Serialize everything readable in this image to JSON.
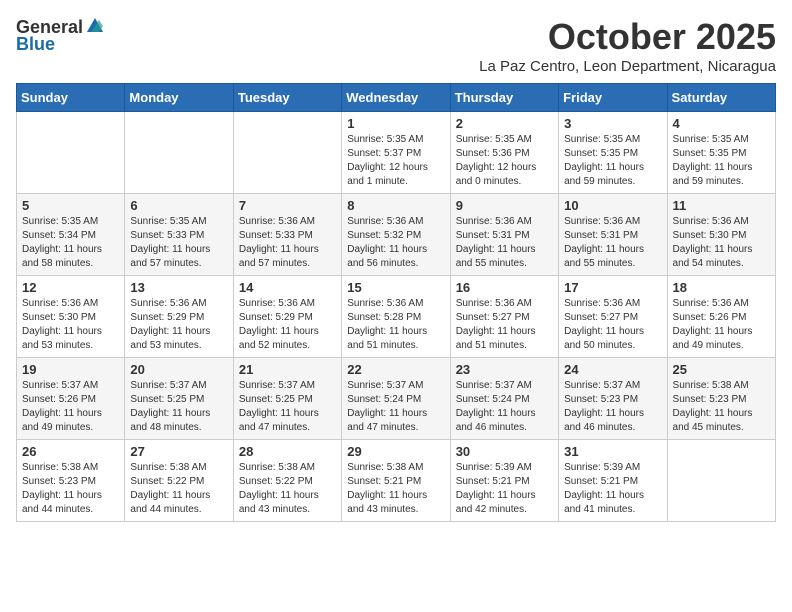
{
  "header": {
    "logo_general": "General",
    "logo_blue": "Blue",
    "month": "October 2025",
    "location": "La Paz Centro, Leon Department, Nicaragua"
  },
  "weekdays": [
    "Sunday",
    "Monday",
    "Tuesday",
    "Wednesday",
    "Thursday",
    "Friday",
    "Saturday"
  ],
  "weeks": [
    [
      {
        "day": "",
        "info": ""
      },
      {
        "day": "",
        "info": ""
      },
      {
        "day": "",
        "info": ""
      },
      {
        "day": "1",
        "info": "Sunrise: 5:35 AM\nSunset: 5:37 PM\nDaylight: 12 hours\nand 1 minute."
      },
      {
        "day": "2",
        "info": "Sunrise: 5:35 AM\nSunset: 5:36 PM\nDaylight: 12 hours\nand 0 minutes."
      },
      {
        "day": "3",
        "info": "Sunrise: 5:35 AM\nSunset: 5:35 PM\nDaylight: 11 hours\nand 59 minutes."
      },
      {
        "day": "4",
        "info": "Sunrise: 5:35 AM\nSunset: 5:35 PM\nDaylight: 11 hours\nand 59 minutes."
      }
    ],
    [
      {
        "day": "5",
        "info": "Sunrise: 5:35 AM\nSunset: 5:34 PM\nDaylight: 11 hours\nand 58 minutes."
      },
      {
        "day": "6",
        "info": "Sunrise: 5:35 AM\nSunset: 5:33 PM\nDaylight: 11 hours\nand 57 minutes."
      },
      {
        "day": "7",
        "info": "Sunrise: 5:36 AM\nSunset: 5:33 PM\nDaylight: 11 hours\nand 57 minutes."
      },
      {
        "day": "8",
        "info": "Sunrise: 5:36 AM\nSunset: 5:32 PM\nDaylight: 11 hours\nand 56 minutes."
      },
      {
        "day": "9",
        "info": "Sunrise: 5:36 AM\nSunset: 5:31 PM\nDaylight: 11 hours\nand 55 minutes."
      },
      {
        "day": "10",
        "info": "Sunrise: 5:36 AM\nSunset: 5:31 PM\nDaylight: 11 hours\nand 55 minutes."
      },
      {
        "day": "11",
        "info": "Sunrise: 5:36 AM\nSunset: 5:30 PM\nDaylight: 11 hours\nand 54 minutes."
      }
    ],
    [
      {
        "day": "12",
        "info": "Sunrise: 5:36 AM\nSunset: 5:30 PM\nDaylight: 11 hours\nand 53 minutes."
      },
      {
        "day": "13",
        "info": "Sunrise: 5:36 AM\nSunset: 5:29 PM\nDaylight: 11 hours\nand 53 minutes."
      },
      {
        "day": "14",
        "info": "Sunrise: 5:36 AM\nSunset: 5:29 PM\nDaylight: 11 hours\nand 52 minutes."
      },
      {
        "day": "15",
        "info": "Sunrise: 5:36 AM\nSunset: 5:28 PM\nDaylight: 11 hours\nand 51 minutes."
      },
      {
        "day": "16",
        "info": "Sunrise: 5:36 AM\nSunset: 5:27 PM\nDaylight: 11 hours\nand 51 minutes."
      },
      {
        "day": "17",
        "info": "Sunrise: 5:36 AM\nSunset: 5:27 PM\nDaylight: 11 hours\nand 50 minutes."
      },
      {
        "day": "18",
        "info": "Sunrise: 5:36 AM\nSunset: 5:26 PM\nDaylight: 11 hours\nand 49 minutes."
      }
    ],
    [
      {
        "day": "19",
        "info": "Sunrise: 5:37 AM\nSunset: 5:26 PM\nDaylight: 11 hours\nand 49 minutes."
      },
      {
        "day": "20",
        "info": "Sunrise: 5:37 AM\nSunset: 5:25 PM\nDaylight: 11 hours\nand 48 minutes."
      },
      {
        "day": "21",
        "info": "Sunrise: 5:37 AM\nSunset: 5:25 PM\nDaylight: 11 hours\nand 47 minutes."
      },
      {
        "day": "22",
        "info": "Sunrise: 5:37 AM\nSunset: 5:24 PM\nDaylight: 11 hours\nand 47 minutes."
      },
      {
        "day": "23",
        "info": "Sunrise: 5:37 AM\nSunset: 5:24 PM\nDaylight: 11 hours\nand 46 minutes."
      },
      {
        "day": "24",
        "info": "Sunrise: 5:37 AM\nSunset: 5:23 PM\nDaylight: 11 hours\nand 46 minutes."
      },
      {
        "day": "25",
        "info": "Sunrise: 5:38 AM\nSunset: 5:23 PM\nDaylight: 11 hours\nand 45 minutes."
      }
    ],
    [
      {
        "day": "26",
        "info": "Sunrise: 5:38 AM\nSunset: 5:23 PM\nDaylight: 11 hours\nand 44 minutes."
      },
      {
        "day": "27",
        "info": "Sunrise: 5:38 AM\nSunset: 5:22 PM\nDaylight: 11 hours\nand 44 minutes."
      },
      {
        "day": "28",
        "info": "Sunrise: 5:38 AM\nSunset: 5:22 PM\nDaylight: 11 hours\nand 43 minutes."
      },
      {
        "day": "29",
        "info": "Sunrise: 5:38 AM\nSunset: 5:21 PM\nDaylight: 11 hours\nand 43 minutes."
      },
      {
        "day": "30",
        "info": "Sunrise: 5:39 AM\nSunset: 5:21 PM\nDaylight: 11 hours\nand 42 minutes."
      },
      {
        "day": "31",
        "info": "Sunrise: 5:39 AM\nSunset: 5:21 PM\nDaylight: 11 hours\nand 41 minutes."
      },
      {
        "day": "",
        "info": ""
      }
    ]
  ]
}
